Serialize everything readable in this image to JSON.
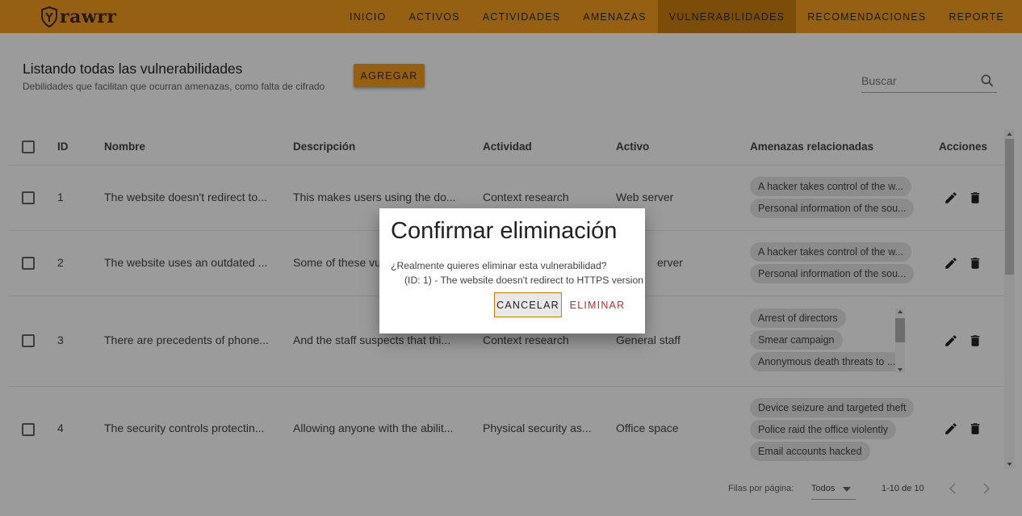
{
  "app": {
    "logo_text": "rawrr"
  },
  "nav": {
    "items": [
      {
        "label": "INICIO"
      },
      {
        "label": "ACTIVOS"
      },
      {
        "label": "ACTIVIDADES"
      },
      {
        "label": "AMENAZAS"
      },
      {
        "label": "VULNERABILIDADES"
      },
      {
        "label": "RECOMENDACIONES"
      },
      {
        "label": "REPORTE"
      }
    ],
    "active": "VULNERABILIDADES"
  },
  "header": {
    "title": "Listando todas las vulnerabilidades",
    "subtitle": "Debilidades que facilitan que ocurran amenazas, como falta de cifrado",
    "add_label": "AGREGAR"
  },
  "search": {
    "placeholder": "Buscar"
  },
  "table": {
    "columns": [
      "ID",
      "Nombre",
      "Descripción",
      "Actividad",
      "Activo",
      "Amenazas relacionadas",
      "Acciones"
    ],
    "rows": [
      {
        "id": "1",
        "nombre": "The website doesn't redirect to...",
        "descripcion": "This makes users using the do...",
        "actividad": "Context research",
        "activo": "Web server",
        "amenazas": [
          "A hacker takes control of the w...",
          "Personal information of the sou..."
        ]
      },
      {
        "id": "2",
        "nombre": "The website uses an outdated ...",
        "descripcion": "Some of these vul",
        "actividad": "",
        "activo": "erver",
        "amenazas": [
          "A hacker takes control of the w...",
          "Personal information of the sou..."
        ]
      },
      {
        "id": "3",
        "nombre": "There are precedents of phone...",
        "descripcion": "And the staff suspects that thi...",
        "actividad": "Context research",
        "activo": "General staff",
        "amenazas": [
          "Arrest of directors",
          "Smear campaign",
          "Anonymous death threats to ..."
        ]
      },
      {
        "id": "4",
        "nombre": "The security controls protectin...",
        "descripcion": "Allowing anyone with the abilit...",
        "actividad": "Physical security as...",
        "activo": "Office space",
        "amenazas": [
          "Device seizure and targeted theft",
          "Police raid the office violently",
          "Email accounts hacked"
        ]
      }
    ]
  },
  "footer": {
    "rows_label": "Filas por página:",
    "rows_value": "Todos",
    "range": "1-10 de 10"
  },
  "dialog": {
    "title": "Confirmar eliminación",
    "question": "¿Realmente quieres eliminar esta vulnerabilidad?",
    "detail": "(ID: 1) - The website doesn't redirect to HTTPS version",
    "cancel_label": "CANCELAR",
    "delete_label": "ELIMINAR"
  },
  "colors": {
    "brand": "#f19c1c",
    "brand_active": "#c97d10",
    "danger": "#c62828"
  },
  "icons": [
    "shield-logo-icon",
    "search-icon",
    "edit-icon",
    "delete-icon",
    "dropdown-arrow-icon",
    "prev-page-icon",
    "next-page-icon"
  ]
}
